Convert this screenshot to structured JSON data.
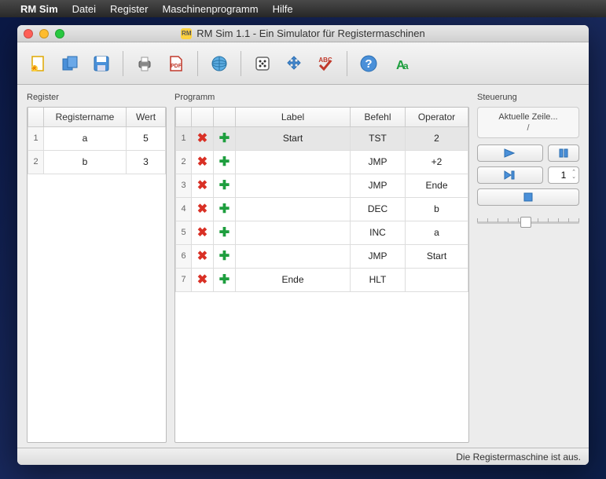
{
  "menubar": {
    "app": "RM Sim",
    "items": [
      "Datei",
      "Register",
      "Maschinenprogramm",
      "Hilfe"
    ]
  },
  "window": {
    "title": "RM Sim 1.1 - Ein Simulator für Registermaschinen"
  },
  "panels": {
    "register": "Register",
    "program": "Programm",
    "control": "Steuerung"
  },
  "register_table": {
    "headers": [
      "Registername",
      "Wert"
    ],
    "rows": [
      {
        "num": "1",
        "name": "a",
        "value": "5"
      },
      {
        "num": "2",
        "name": "b",
        "value": "3"
      }
    ]
  },
  "program_table": {
    "headers": [
      "Label",
      "Befehl",
      "Operator"
    ],
    "rows": [
      {
        "num": "1",
        "label": "Start",
        "cmd": "TST",
        "op": "2",
        "selected": true
      },
      {
        "num": "2",
        "label": "",
        "cmd": "JMP",
        "op": "+2"
      },
      {
        "num": "3",
        "label": "",
        "cmd": "JMP",
        "op": "Ende"
      },
      {
        "num": "4",
        "label": "",
        "cmd": "DEC",
        "op": "b"
      },
      {
        "num": "5",
        "label": "",
        "cmd": "INC",
        "op": "a"
      },
      {
        "num": "6",
        "label": "",
        "cmd": "JMP",
        "op": "Start"
      },
      {
        "num": "7",
        "label": "Ende",
        "cmd": "HLT",
        "op": ""
      }
    ]
  },
  "control": {
    "current_line_label": "Aktuelle Zeile...",
    "separator": "/",
    "step_value": "1"
  },
  "statusbar": {
    "text": "Die Registermaschine ist aus."
  }
}
